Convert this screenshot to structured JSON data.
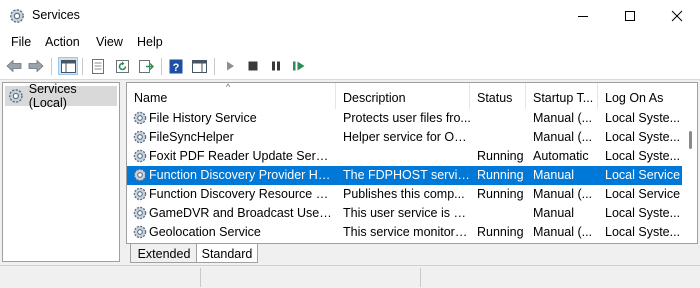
{
  "window": {
    "title": "Services",
    "icons": {
      "app": "gear-icon",
      "minimize": "minimize-icon",
      "maximize": "maximize-icon",
      "close": "close-icon"
    }
  },
  "menu": {
    "items": [
      "File",
      "Action",
      "View",
      "Help"
    ]
  },
  "toolbar": {
    "buttons": [
      "back-arrow-icon",
      "forward-arrow-icon",
      "show-hide-console-tree-icon",
      "properties-icon",
      "refresh-icon",
      "export-list-icon",
      "help-icon",
      "show-action-pane-icon",
      "start-service-icon",
      "stop-service-icon",
      "pause-service-icon",
      "restart-service-icon"
    ],
    "colors": {
      "play": "#2e8b57",
      "stop": "#3a3a3a",
      "help": "#1f4fa5"
    }
  },
  "tree": {
    "root_label": "Services (Local)"
  },
  "list": {
    "columns": [
      "Name",
      "Description",
      "Status",
      "Startup T...",
      "Log On As"
    ],
    "rows": [
      {
        "name": "File History Service",
        "description": "Protects user files fro...",
        "status": "",
        "startup": "Manual (...",
        "logon": "Local Syste...",
        "selected": false
      },
      {
        "name": "FileSyncHelper",
        "description": "Helper service for On...",
        "status": "",
        "startup": "Manual (...",
        "logon": "Local Syste...",
        "selected": false
      },
      {
        "name": "Foxit PDF Reader Update Service",
        "description": "",
        "status": "Running",
        "startup": "Automatic",
        "logon": "Local Syste...",
        "selected": false
      },
      {
        "name": "Function Discovery Provider Host",
        "description": "The FDPHOST service...",
        "status": "Running",
        "startup": "Manual",
        "logon": "Local Service",
        "selected": true
      },
      {
        "name": "Function Discovery Resource Pu...",
        "description": "Publishes this comp...",
        "status": "Running",
        "startup": "Manual (...",
        "logon": "Local Service",
        "selected": false
      },
      {
        "name": "GameDVR and Broadcast User Se...",
        "description": "This user service is us...",
        "status": "",
        "startup": "Manual",
        "logon": "Local Syste...",
        "selected": false
      },
      {
        "name": "Geolocation Service",
        "description": "This service monitors...",
        "status": "Running",
        "startup": "Manual (...",
        "logon": "Local Syste...",
        "selected": false
      }
    ],
    "selection_color": "#0078d7"
  },
  "tabs": {
    "extended": "Extended",
    "standard": "Standard",
    "active": "Standard"
  }
}
